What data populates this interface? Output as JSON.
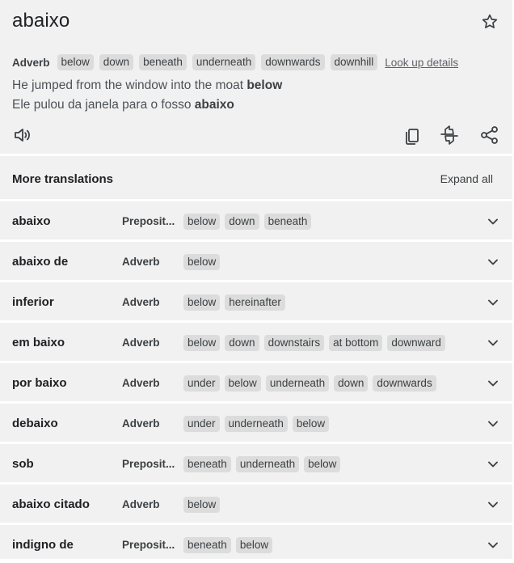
{
  "headword": "abaixo",
  "definition": {
    "pos": "Adverb",
    "translations": [
      "below",
      "down",
      "beneath",
      "underneath",
      "downwards",
      "downhill"
    ],
    "look_up_label": "Look up details"
  },
  "examples": {
    "source_prefix": "He jumped from the window into the moat ",
    "source_bold": "below",
    "target_prefix": "Ele pulou da janela para o fosso ",
    "target_bold": "abaixo"
  },
  "more_translations": {
    "title": "More translations",
    "expand_label": "Expand all",
    "rows": [
      {
        "word": "abaixo",
        "pos": "Preposit...",
        "chips": [
          "below",
          "down",
          "beneath"
        ]
      },
      {
        "word": "abaixo de",
        "pos": "Adverb",
        "chips": [
          "below"
        ]
      },
      {
        "word": "inferior",
        "pos": "Adverb",
        "chips": [
          "below",
          "hereinafter"
        ]
      },
      {
        "word": "em baixo",
        "pos": "Adverb",
        "chips": [
          "below",
          "down",
          "downstairs",
          "at bottom",
          "downward"
        ]
      },
      {
        "word": "por baixo",
        "pos": "Adverb",
        "chips": [
          "under",
          "below",
          "underneath",
          "down",
          "downwards"
        ]
      },
      {
        "word": "debaixo",
        "pos": "Adverb",
        "chips": [
          "under",
          "underneath",
          "below"
        ]
      },
      {
        "word": "sob",
        "pos": "Preposit...",
        "chips": [
          "beneath",
          "underneath",
          "below"
        ]
      },
      {
        "word": "abaixo citado",
        "pos": "Adverb",
        "chips": [
          "below"
        ]
      },
      {
        "word": "indigno de",
        "pos": "Preposit...",
        "chips": [
          "beneath",
          "below"
        ]
      }
    ]
  },
  "icons": {
    "favorite": "star-outline-icon",
    "listen": "speaker-icon",
    "copy": "copy-icon",
    "feedback": "feedback-icon",
    "share": "share-icon",
    "expand_row": "chevron-down-icon"
  },
  "colors": {
    "card_bg": "#f1f1f1",
    "chip_bg": "#dcdcdc",
    "text": "#202124",
    "secondary": "#5f6368"
  }
}
